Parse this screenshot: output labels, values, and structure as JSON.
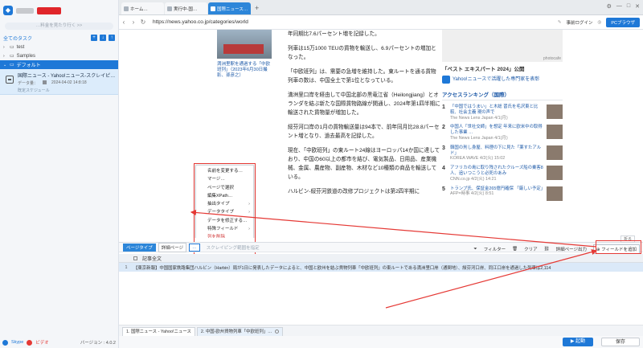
{
  "sidebar": {
    "search_placeholder": "…料金を見たり行く >>",
    "tasks_label": "全てのタスク",
    "folders": [
      {
        "label": "test"
      },
      {
        "label": "Samples"
      },
      {
        "label": "デフォルト"
      }
    ],
    "task": {
      "title": "国際ニュース - Yahoo!ニュース-スクレイピ…",
      "meta_label": "データ量：",
      "date": "2024-04-02 14:8:18",
      "status": "既定スケジュール"
    },
    "skype_label": "Skype",
    "youtube_label": "ビデオ",
    "version": "バージョン : 4.0.2"
  },
  "browser": {
    "tabs": [
      {
        "label": "ホーム…"
      },
      {
        "label": "実行中-国…"
      },
      {
        "label": "国際ニュース…"
      }
    ],
    "url": "https://news.yahoo.co.jp/categories/world",
    "login_label": "事前ログイン",
    "pc_browser_label": "PCブラウザ"
  },
  "page": {
    "image_caption": "満洲里駅を通過する「中欧班列」（2023年6月30日撮影、孫彦之）",
    "paragraphs": [
      "年同期比7.6パーセント増を記録した。",
      "列車は15万1000 TEUの貨物を輸送し、6.9パーセントの増加となった。",
      "「中欧班列」は、需要の急増を維持した。東ルートを通る貨物列車の数は、中国全土で第1位となっている。",
      "満洲里口岸を経由して中国北部の黒竜江省（Heilongjiang）とオランダを結ぶ新たな国際貨物路線が開通し、2024年第1四半期に輸送された貨物量が増加した。",
      "綏芬河口岸の1月の貨物輸送量は94本で、前年同月比28.8パーセント増となり、過去最高を記録した。",
      "現在、「中欧班列」の東ルート24線はヨーロッパ14か国に達しており、中国の60以上の都市を結び、電気製品、日用品、産業機械、金属、農産物、副産物、木材など10種類の商品を輸送している。",
      "ハルビン-綏芬河鉄道の改修プロジェクトは第2四半期に"
    ],
    "rail": {
      "ad_label": "photocafe",
      "heading": "「ベスト エキスパート 2024」公開",
      "link": "Yahoo!ニュースで活躍した専門家を表彰",
      "ranking_title": "アクセスランキング（国際）",
      "ranking": [
        {
          "num": "1",
          "text": "「中国ではうまい」と木総 習氏を毛沢東と比較、社会主義 現の声で",
          "src": "The News Lens Japan 4/1(月)"
        },
        {
          "num": "2",
          "text": "中国人「世社交師」を想定 年来に欧米中の取得した事業 …",
          "src": "The News Lens Japan 4/1(月)"
        },
        {
          "num": "3",
          "text": "韓国の刑し身屋、料理の下に見た「薬すたアルド」",
          "src": "KOREA WAVE 4/2(火) 15:02"
        },
        {
          "num": "4",
          "text": "アフリカの島に取り残されたクルーズ船の乗客8人、追いつこうと必死のあみ",
          "src": "CNN.co.jp 4/2(火) 14:21"
        },
        {
          "num": "5",
          "text": "トランプ氏、保証金265億円確保 「厳しい予定」",
          "src": "AFP=時事 4/2(火) 8:51"
        }
      ]
    }
  },
  "context_menu": {
    "items": [
      {
        "label": "名前を変更する…",
        "sub": false
      },
      {
        "label": "マージ…",
        "sub": false
      },
      {
        "label": "ページで選択",
        "sub": false
      },
      {
        "label": "編集XPath…",
        "sub": false
      },
      {
        "label": "抽出タイプ",
        "sub": true
      },
      {
        "label": "データタイプ",
        "sub": true
      },
      {
        "label": "データを修正する…",
        "sub": false
      },
      {
        "label": "特殊フィールド",
        "sub": true
      },
      {
        "label": "列を削除",
        "sub": false,
        "red": true
      }
    ]
  },
  "panel": {
    "page_type_label": "ページタイプ",
    "detail_select": "詳細ページ",
    "field_select": "…",
    "scroll_link": "スクレイピング範囲を指定",
    "fold_label": "折る",
    "filter_label": "フィルター",
    "clear_label": "クリア",
    "detail_page_label": "詳細ページ出力",
    "add_field_label": "フィールドを追加",
    "column_header": "記事全文",
    "row_number": "1",
    "row_text": "【東京新報】中国国家鉄路集団ハルビン（Harbin）局が1日に発表したデータによると、中国と欧州を結ぶ貨物列車「中欧班列」の東ルートである満洲里口岸（通関地）、綏芬河口岸、同江口岸を通過した列車は2,114"
  },
  "task_tabs": [
    {
      "label": "1. 国際ニュース - Yahoo!ニュース"
    },
    {
      "label": "2. 中国-欧州貨物列車「中欧班列」…"
    }
  ],
  "actions": {
    "start_label": "起動",
    "save_label": "保存"
  },
  "colors": {
    "accent": "#1e78d7",
    "highlight_red": "#e53935"
  }
}
